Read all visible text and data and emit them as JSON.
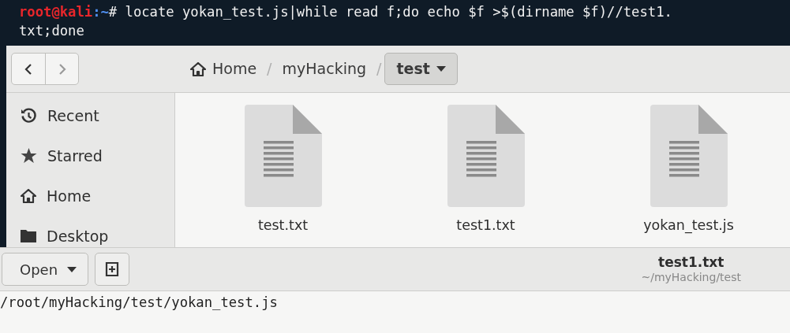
{
  "terminal": {
    "lines": [
      {
        "user": "root@kali",
        "path": ":~",
        "symbol": "#",
        "text": " locate yokan_test.js|while read f;do echo $f >$(dirname $f)//test1."
      },
      {
        "text": "txt;done"
      }
    ]
  },
  "files_window": {
    "nav": [
      {
        "kind": "back",
        "disabled": false
      },
      {
        "kind": "forward",
        "disabled": true
      }
    ],
    "path": [
      {
        "label": "Home",
        "kind": "home",
        "selected": false
      },
      {
        "separator": "/",
        "label": "myHacking",
        "kind": "folder",
        "selected": false
      },
      {
        "separator": "/",
        "label": "test",
        "kind": "folder",
        "selected": true
      }
    ],
    "sidebar": {
      "items": [
        {
          "label": "Recent",
          "kind": "recent"
        },
        {
          "label": "Starred",
          "kind": "starred"
        },
        {
          "label": "Home",
          "kind": "home"
        },
        {
          "label": "Desktop",
          "kind": "desktop"
        }
      ]
    },
    "files": [
      {
        "name": "test.txt"
      },
      {
        "name": "test1.txt"
      },
      {
        "name": "yokan_test.js"
      }
    ]
  },
  "editor_window": {
    "open_button": "Open",
    "title": "test1.txt",
    "subtitle": "~/myHacking/test",
    "content": "/root/myHacking/test/yokan_test.js"
  }
}
